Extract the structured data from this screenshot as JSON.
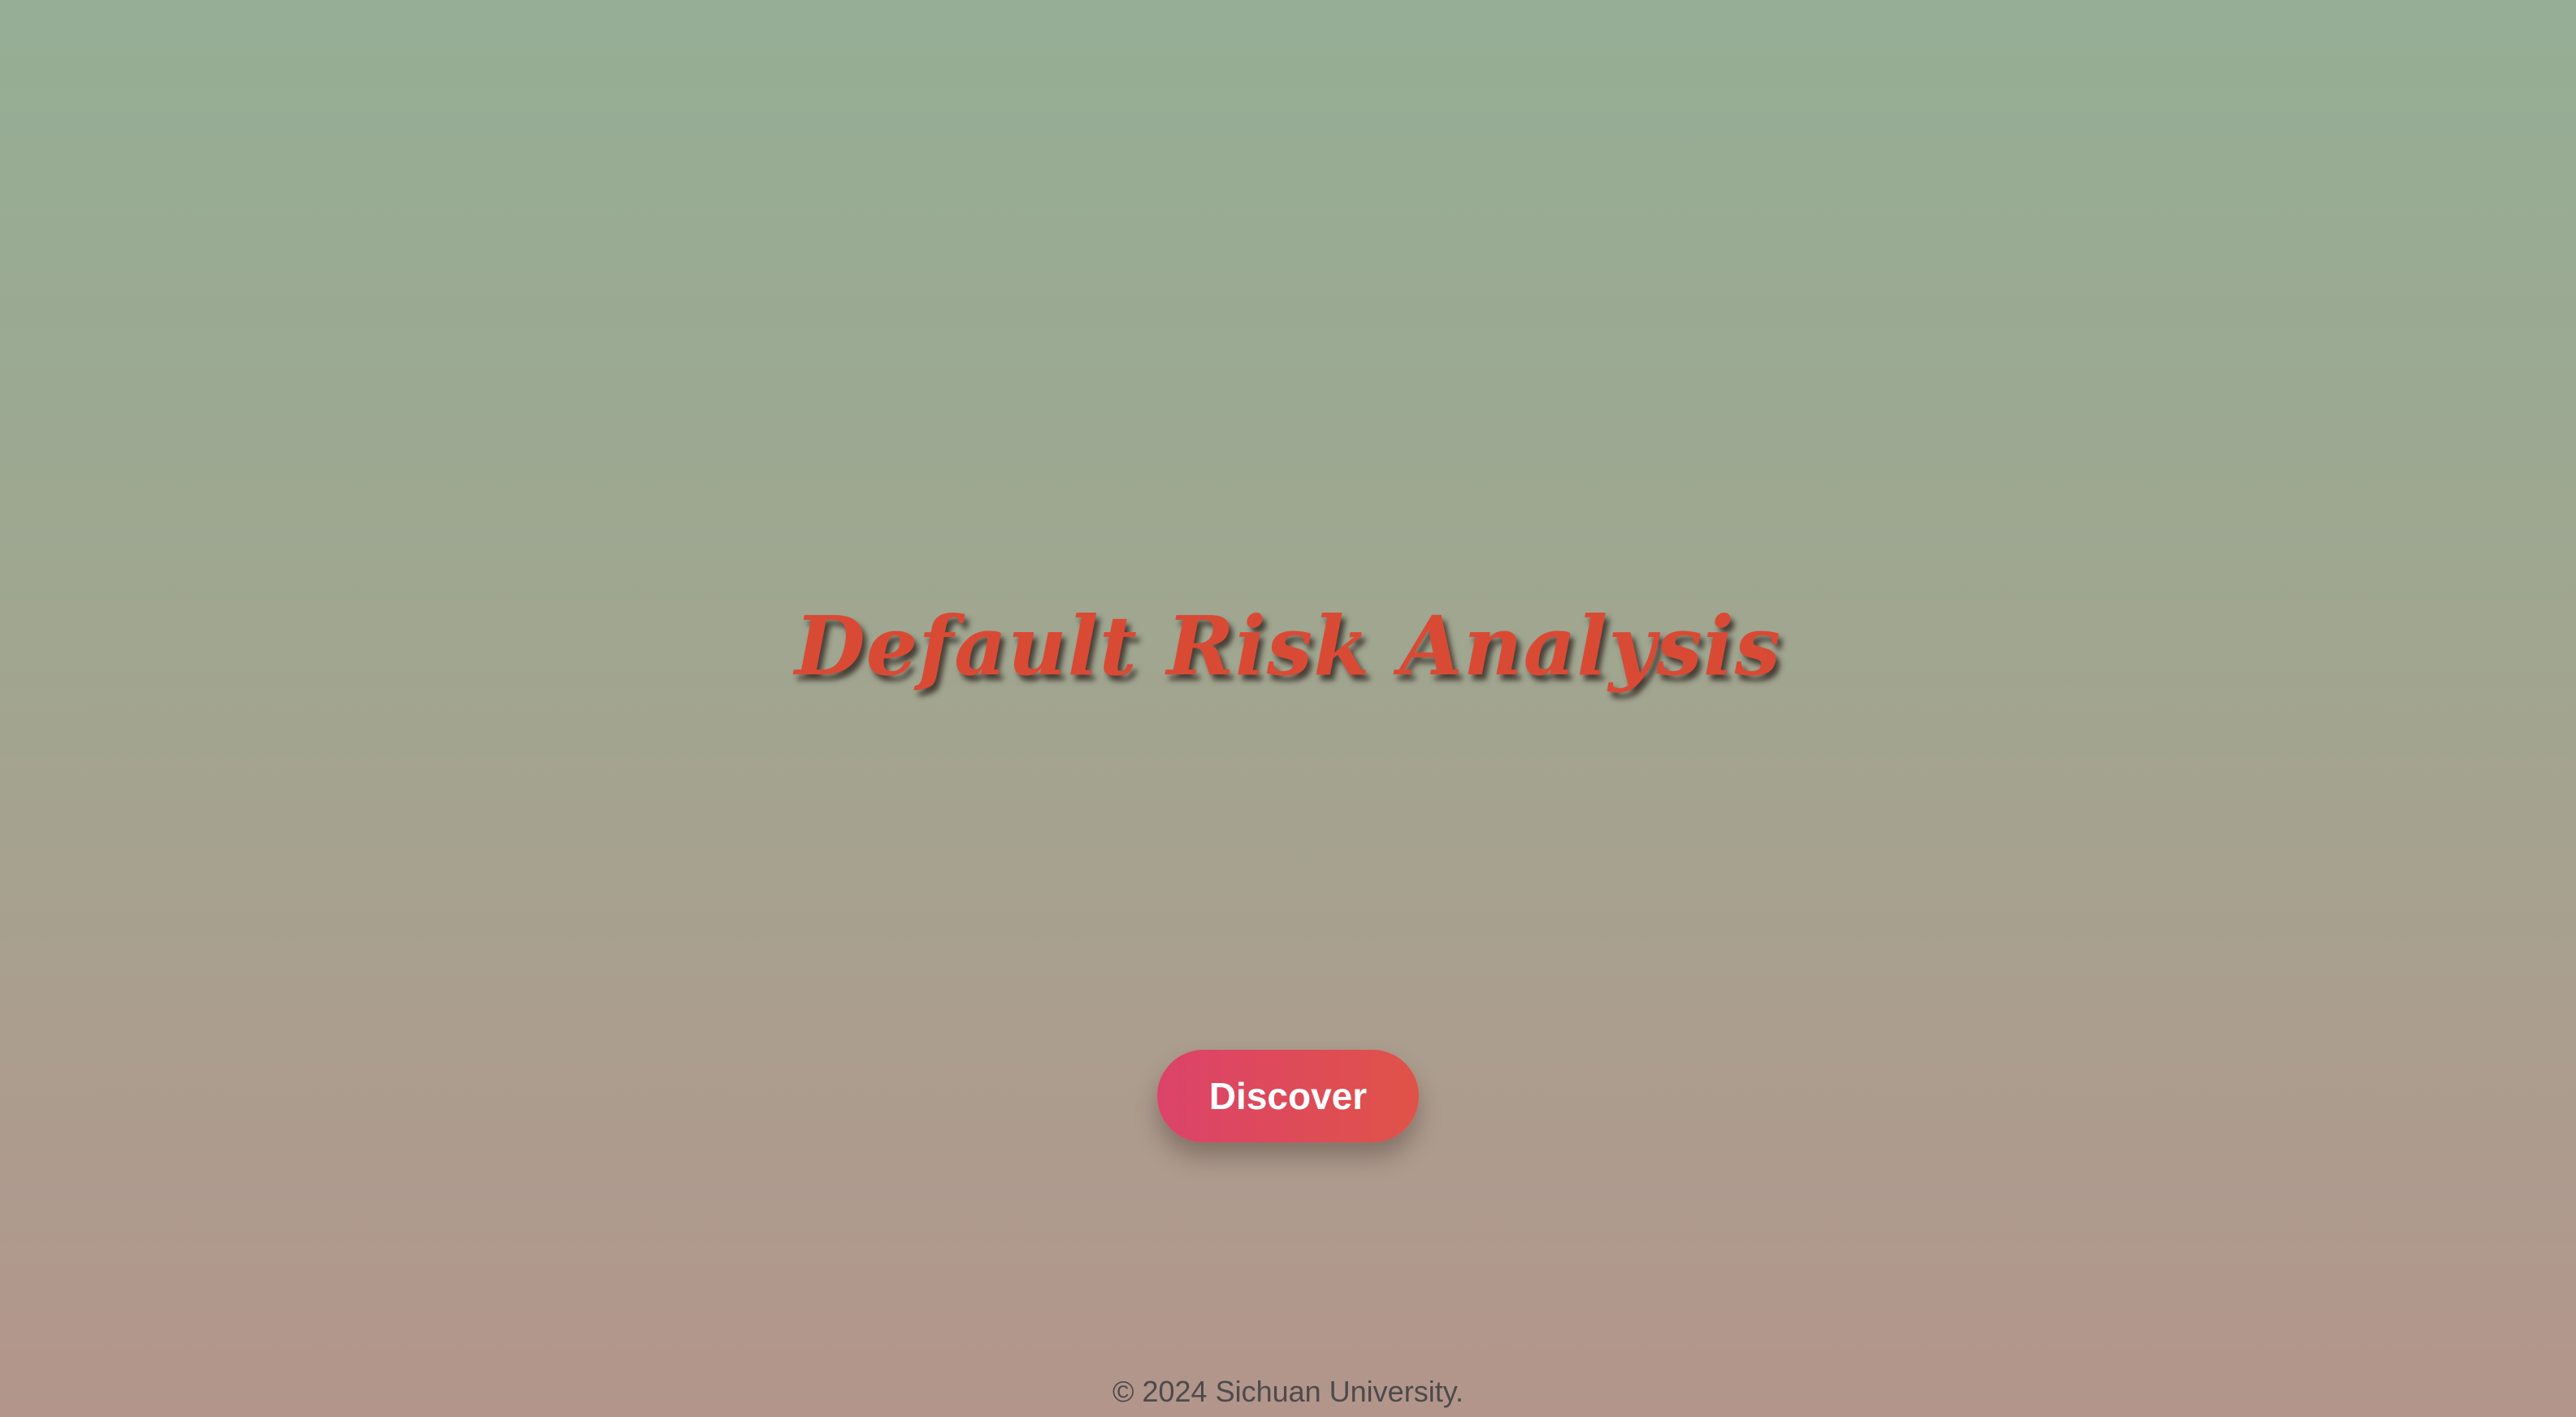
{
  "hero": {
    "title": "Default Risk Analysis"
  },
  "cta": {
    "label": "Discover"
  },
  "footer": {
    "text": "© 2024 Sichuan University."
  },
  "colors": {
    "background_top": "#95ae95",
    "background_bottom": "#b3958c",
    "title": "#d94a35",
    "button_start": "#dc436a",
    "button_end": "#e05248",
    "footer_text": "#4d4a4b"
  }
}
